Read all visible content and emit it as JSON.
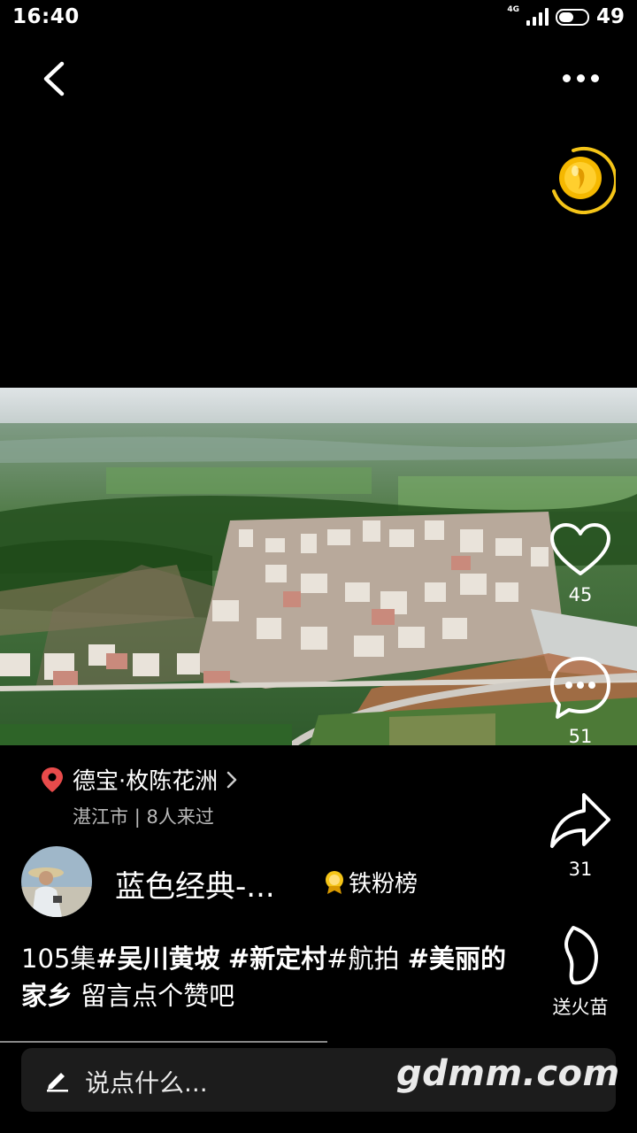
{
  "status_bar": {
    "time": "16:40",
    "network": "4G",
    "battery": "49"
  },
  "icons": {
    "back": "chevron-left-icon",
    "more": "more-dots-icon",
    "coin": "gold-coin-icon",
    "like": "heart-icon",
    "comment": "comment-bubble-icon",
    "share": "share-arrow-icon",
    "gift": "fire-seedling-icon",
    "location": "location-pin-icon",
    "fan_rank": "medal-icon",
    "pencil": "pencil-icon"
  },
  "actions": {
    "likes": "45",
    "comments": "51",
    "shares": "31",
    "gift_label": "送火苗"
  },
  "location": {
    "name": "德宝·枚陈花洲",
    "city": "湛江市",
    "visitors": "8人来过"
  },
  "author": {
    "name": "蓝色经典-...",
    "fan_rank_label": "铁粉榜"
  },
  "caption": {
    "part1": "105集",
    "tag1": "#吴川黄坡",
    "sp1": " ",
    "tag2": "#新定村",
    "tag3": "#航拍",
    "sp2": " ",
    "tag4": "#美丽的家乡",
    "tail": " 留言点个赞吧"
  },
  "comment_bar": {
    "placeholder": "说点什么..."
  },
  "watermark": "gdmm.com",
  "colors": {
    "accent_gold": "#f5c518",
    "pin_red": "#e84b4b"
  }
}
